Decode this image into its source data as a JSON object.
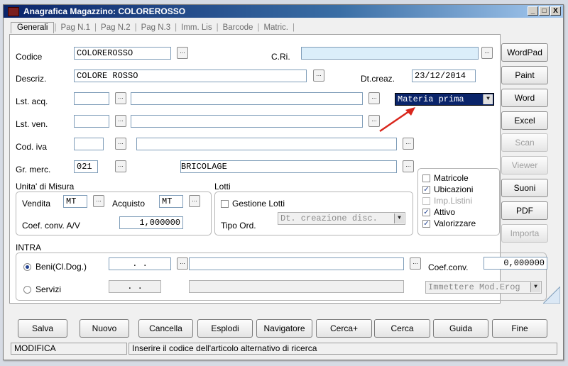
{
  "window": {
    "title": "Anagrafica Magazzino: COLOREROSSO",
    "minimize": "_",
    "maximize": "□",
    "close": "X"
  },
  "tabs": [
    "Generali",
    "Pag N.1",
    "Pag N.2",
    "Pag N.3",
    "Imm. Lis",
    "Barcode",
    "Matric."
  ],
  "tab_separator": "|",
  "dots": "...",
  "form": {
    "codice_label": "Codice",
    "codice_value": "COLOREROSSO",
    "cri_label": "C.Ri.",
    "cri_value": "",
    "descriz_label": "Descriz.",
    "descriz_value": "COLORE ROSSO",
    "dtcreaz_label": "Dt.creaz.",
    "dtcreaz_value": "23/12/2014",
    "lstacq_label": "Lst. acq.",
    "tipo_value": "Materia prima",
    "lstven_label": "Lst. ven.",
    "codiva_label": "Cod. iva",
    "grmerc_label": "Gr. merc.",
    "grmerc_code": "021",
    "grmerc_desc": "BRICOLAGE"
  },
  "misura": {
    "title": "Unita' di Misura",
    "vendita_label": "Vendita",
    "vendita_value": "MT",
    "acquisto_label": "Acquisto",
    "acquisto_value": "MT",
    "coef_label": "Coef. conv. A/V",
    "coef_value": "1,000000"
  },
  "lotti": {
    "title": "Lotti",
    "gestione_label": "Gestione Lotti",
    "tipo_label": "Tipo Ord.",
    "tipo_value": "Dt. creazione disc."
  },
  "checks": [
    {
      "label": "Matricole",
      "checked": false,
      "disabled": false
    },
    {
      "label": "Ubicazioni",
      "checked": true,
      "disabled": false
    },
    {
      "label": "Imp.Listini",
      "checked": false,
      "disabled": true
    },
    {
      "label": "Attivo",
      "checked": true,
      "disabled": false
    },
    {
      "label": "Valorizzare",
      "checked": true,
      "disabled": false
    }
  ],
  "intra": {
    "title": "INTRA",
    "beni_label": "Beni(Cl.Dog.)",
    "beni_value": ". .",
    "servizi_label": "Servizi",
    "servizi_value": ". .",
    "coef_label": "Coef.conv.",
    "coef_value": "0,000000",
    "mod_value": "Immettere Mod.Erog"
  },
  "side_buttons": [
    {
      "label": "WordPad",
      "enabled": true
    },
    {
      "label": "Paint",
      "enabled": true
    },
    {
      "label": "Word",
      "enabled": true
    },
    {
      "label": "Excel",
      "enabled": true
    },
    {
      "label": "Scan",
      "enabled": false
    },
    {
      "label": "Viewer",
      "enabled": false
    },
    {
      "label": "Suoni",
      "enabled": true
    },
    {
      "label": "PDF",
      "enabled": true
    },
    {
      "label": "Importa",
      "enabled": false
    }
  ],
  "bottom_buttons": [
    "Salva",
    "Nuovo",
    "Cancella",
    "Esplodi",
    "Navigatore",
    "Cerca+",
    "Cerca",
    "Guida",
    "Fine"
  ],
  "status": {
    "mode": "MODIFICA",
    "message": "Inserire il codice dell'articolo alternativo di ricerca"
  },
  "colors": {
    "title_bar": "#0a246a",
    "cri_field": "#dbeefa",
    "tipo_select_bg": "#0a246a",
    "arrow": "#d9261c"
  }
}
